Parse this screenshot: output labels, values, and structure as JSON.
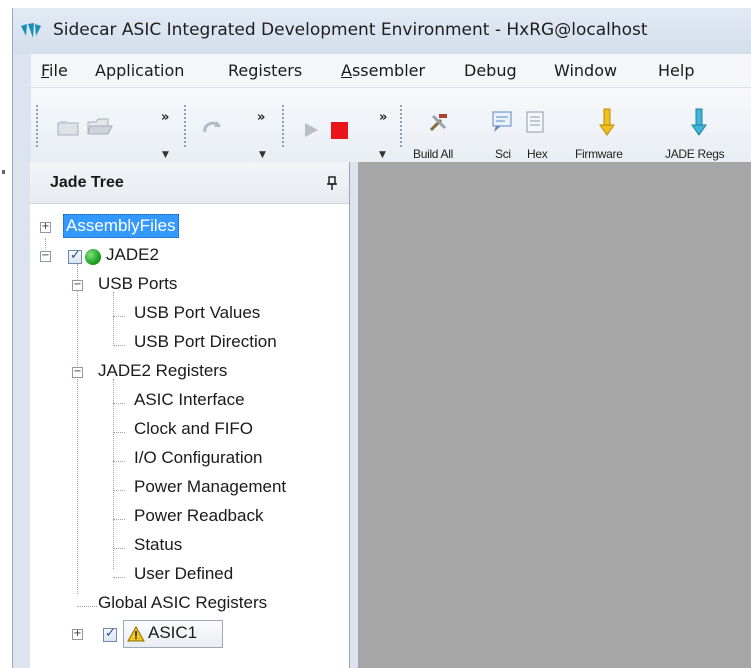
{
  "window": {
    "title": "Sidecar ASIC Integrated Development Environment - HxRG@localhost",
    "brand_color": "#1a8fb8"
  },
  "menu": {
    "items": [
      {
        "label": "File",
        "mnemonic": "F"
      },
      {
        "label": "Application"
      },
      {
        "label": "Registers"
      },
      {
        "label": "Assembler",
        "mnemonic": "A"
      },
      {
        "label": "Debug"
      },
      {
        "label": "Window"
      },
      {
        "label": "Help"
      }
    ]
  },
  "toolbar": {
    "overflow": "»",
    "dropdown": "▼",
    "buttons": [
      {
        "label": "Build All",
        "icon": "build-icon"
      },
      {
        "label": "Sci",
        "icon": "sci-icon"
      },
      {
        "label": "Hex",
        "icon": "hex-icon"
      },
      {
        "label": "Firmware",
        "icon": "firmware-download-icon"
      },
      {
        "label": "JADE Regs",
        "icon": "jade-regs-download-icon"
      }
    ],
    "run_color": "#b9bfc6",
    "stop_color": "#e8141a"
  },
  "pane": {
    "title": "Jade Tree",
    "pin": "pin-icon"
  },
  "tree": {
    "expand_plus": "+",
    "expand_minus": "−",
    "check": "✓",
    "warning": "!",
    "assembly_files": "AssemblyFiles",
    "jade2": "JADE2",
    "usb_ports": "USB Ports",
    "usb_port_values": "USB Port Values",
    "usb_port_direction": "USB Port Direction",
    "jade2_registers": "JADE2 Registers",
    "registers": [
      "ASIC Interface",
      "Clock and FIFO",
      "I/O Configuration",
      "Power Management",
      "Power Readback",
      "Status",
      "User Defined"
    ],
    "global_asic_registers": "Global ASIC Registers",
    "asic1": "ASIC1",
    "selection_color": "#3399ff",
    "status_color": "#1ea11e"
  }
}
